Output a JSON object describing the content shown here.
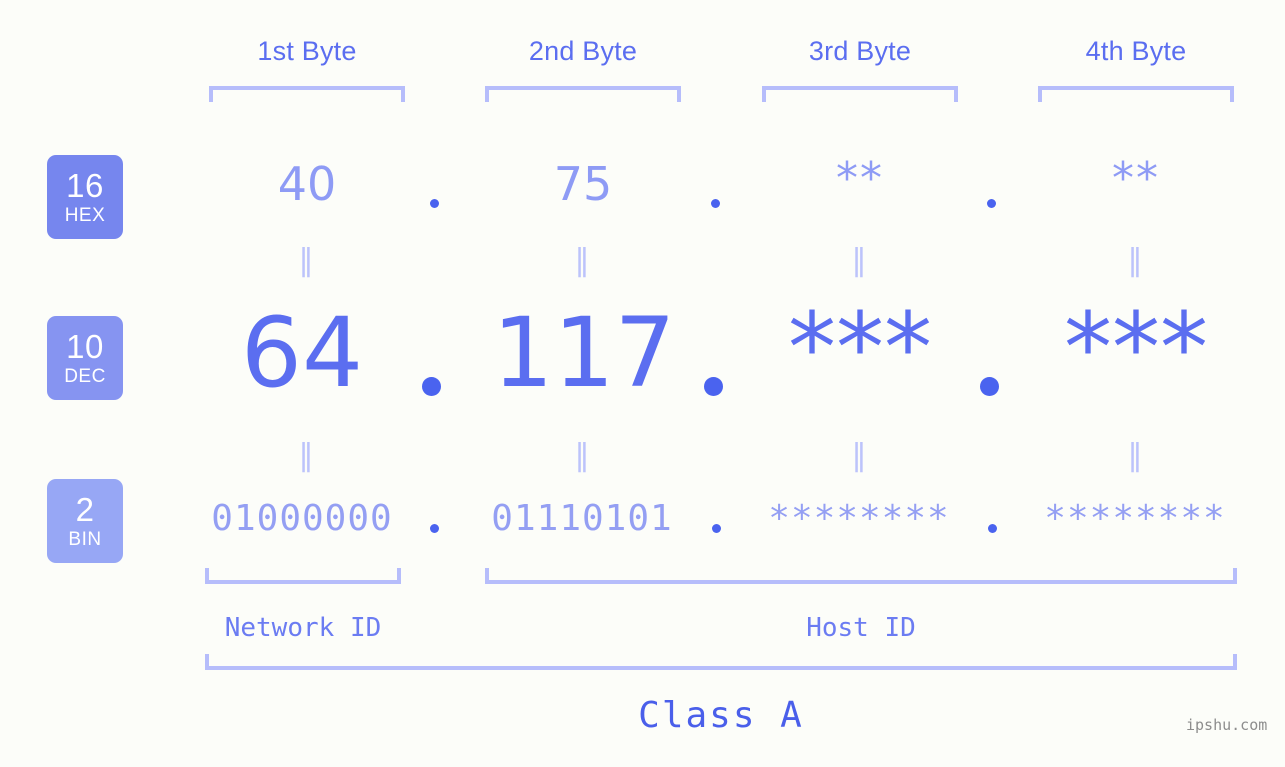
{
  "watermark": "ipshu.com",
  "headers": [
    {
      "label": "1st Byte"
    },
    {
      "label": "2nd Byte"
    },
    {
      "label": "3rd Byte"
    },
    {
      "label": "4th Byte"
    }
  ],
  "radix_badges": [
    {
      "number": "16",
      "name": "HEX",
      "color": "#7686ee"
    },
    {
      "number": "10",
      "name": "DEC",
      "color": "#8694f1"
    },
    {
      "number": "2",
      "name": "BIN",
      "color": "#97a7f5"
    }
  ],
  "rows": {
    "hex": {
      "values": [
        "40",
        "75",
        "**",
        "**"
      ]
    },
    "dec": {
      "values": [
        "64",
        "117",
        "***",
        "***"
      ]
    },
    "bin": {
      "values": [
        "01000000",
        "01110101",
        "********",
        "********"
      ]
    }
  },
  "separators": [
    "‖",
    "‖",
    "‖",
    "‖"
  ],
  "dot": ".",
  "segments": {
    "network_id": "Network ID",
    "host_id": "Host ID",
    "class": "Class A"
  },
  "colors": {
    "background": "#fcfdf9",
    "accent_strong": "#4a63ef",
    "accent_mid": "#5b6ef0",
    "accent_light": "#b6bdfb",
    "hex_text": "#8e9bf5",
    "bin_text": "#949ff3"
  }
}
